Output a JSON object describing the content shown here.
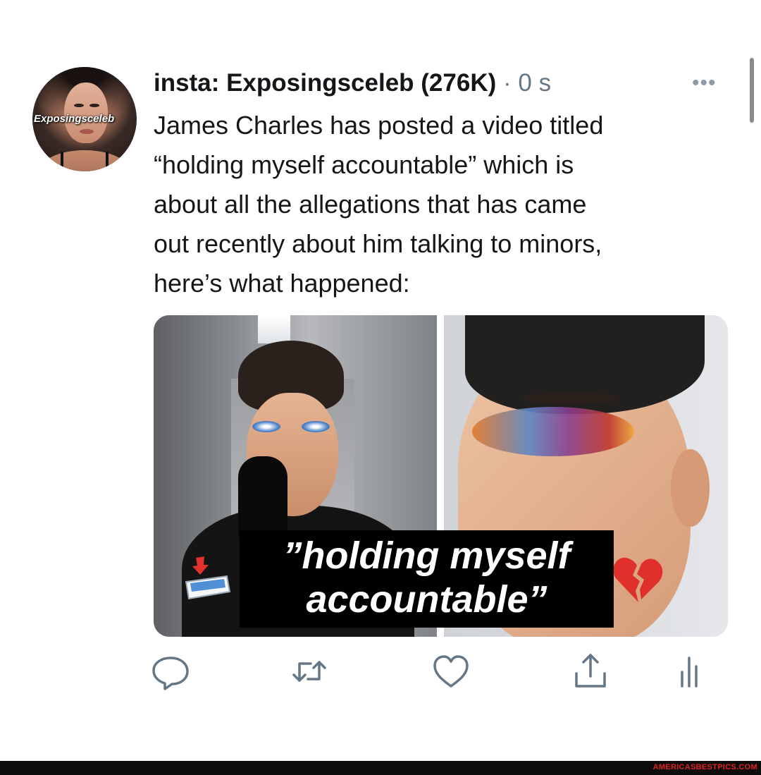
{
  "tweet": {
    "display_name": "insta: Exposingsceleb (276K)",
    "separator": "·",
    "timestamp": "0 s",
    "more_label": "•••",
    "avatar_label": "Exposingsceleb",
    "text_lines": [
      "James Charles has posted a video titled",
      "“holding myself accountable” which is",
      "about all the allegations that has came",
      "out recently about him talking to minors,",
      "here’s what happened:"
    ],
    "media": {
      "caption_line1": "”holding myself",
      "caption_line2": "accountable”",
      "emoji_left": "inbox-tray-icon",
      "emoji_right": "broken-heart-icon"
    }
  },
  "actions": {
    "reply": "reply-icon",
    "retweet": "retweet-icon",
    "like": "like-icon",
    "share": "share-icon",
    "analytics": "analytics-icon"
  },
  "colors": {
    "text": "#14171a",
    "muted": "#657786",
    "icon": "#657786",
    "watermark": "#e0211f"
  },
  "footer": {
    "watermark": "AMERICASBESTPICS.COM"
  }
}
